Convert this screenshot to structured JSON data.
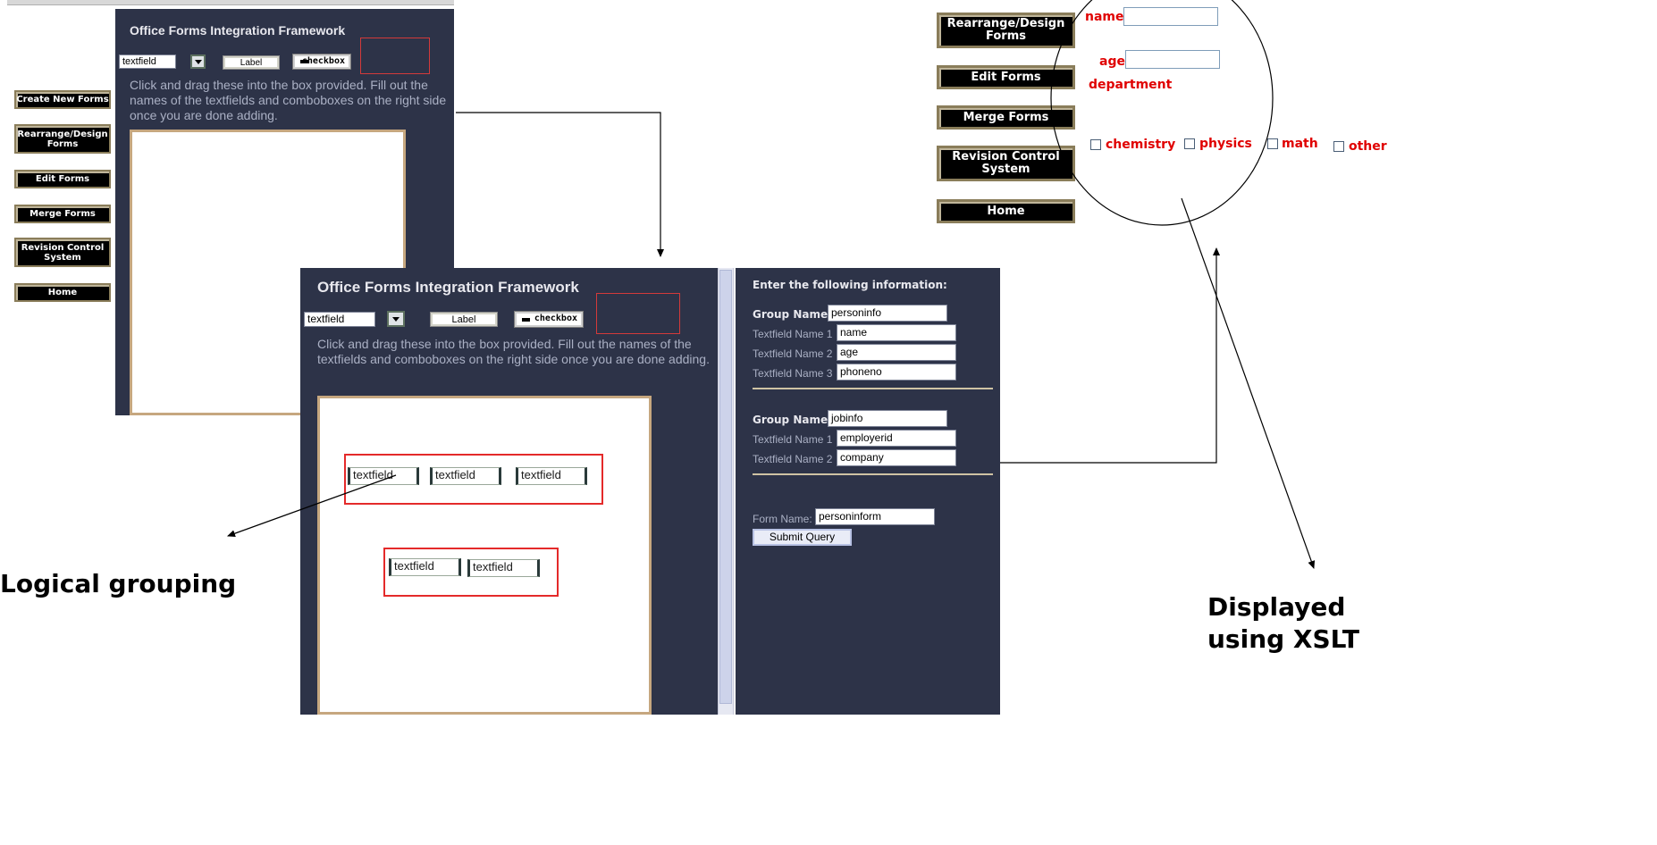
{
  "app": {
    "title": "Office Forms Integration Framework"
  },
  "palette": {
    "textfield_value": "textfield",
    "label_text": "Label",
    "checkbox_text": "checkbox"
  },
  "description": "Click and drag these into the box provided. Fill out the names of the textfields and comboboxes on the right side once you are done adding.",
  "left_nav": [
    {
      "label": "Create New Forms"
    },
    {
      "label": "Rearrange/Design Forms"
    },
    {
      "label": "Edit Forms"
    },
    {
      "label": "Merge Forms"
    },
    {
      "label": "Revision Control System"
    },
    {
      "label": "Home"
    }
  ],
  "canvas": {
    "group1_fields": [
      "textfield",
      "textfield",
      "textfield"
    ],
    "group2_fields": [
      "textfield",
      "textfield"
    ]
  },
  "form_panel": {
    "heading": "Enter the following information:",
    "groups": [
      {
        "label": "Group Name1",
        "value": "personinfo",
        "fields": [
          {
            "label": "Textfield Name 1",
            "value": "name"
          },
          {
            "label": "Textfield Name 2",
            "value": "age"
          },
          {
            "label": "Textfield Name 3",
            "value": "phoneno"
          }
        ]
      },
      {
        "label": "Group Name2",
        "value": "jobinfo",
        "fields": [
          {
            "label": "Textfield Name 1",
            "value": "employerid"
          },
          {
            "label": "Textfield Name 2",
            "value": "company"
          }
        ]
      }
    ],
    "form_name_label": "Form Name:",
    "form_name_value": "personinform",
    "submit_label": "Submit Query"
  },
  "right_nav": [
    {
      "label": "Rearrange/Design Forms"
    },
    {
      "label": "Edit Forms"
    },
    {
      "label": "Merge Forms"
    },
    {
      "label": "Revision Control System"
    },
    {
      "label": "Home"
    }
  ],
  "xslt_form": {
    "name_label": "name",
    "age_label": "age",
    "department_label": "department",
    "checkboxes": [
      "chemistry",
      "physics",
      "math",
      "other"
    ]
  },
  "captions": {
    "logical_grouping": "Logical grouping",
    "displayed_using_xslt": "Displayed using XSLT"
  },
  "colors": {
    "panel_bg": "#2d3348",
    "group_border": "#e42a2a",
    "xslt_label": "#e00000"
  }
}
